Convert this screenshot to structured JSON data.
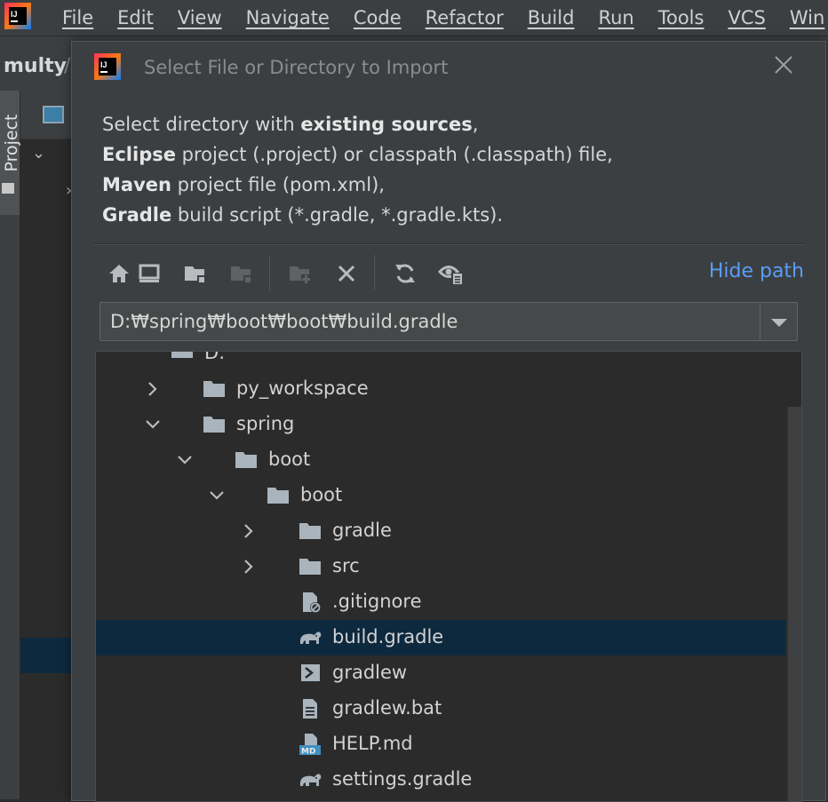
{
  "menubar": {
    "items": [
      "File",
      "Edit",
      "View",
      "Navigate",
      "Code",
      "Refactor",
      "Build",
      "Run",
      "Tools",
      "VCS",
      "Win"
    ]
  },
  "project": {
    "name": "multy",
    "slash": "/",
    "tool_window_label": "Project"
  },
  "dialog": {
    "title": "Select File or Directory to Import",
    "description": {
      "line1_pre": "Select directory with ",
      "line1_bold": "existing sources",
      "line1_post": ",",
      "line2_bold": "Eclipse",
      "line2_post": " project (.project) or classpath (.classpath) file,",
      "line3_bold": "Maven",
      "line3_post": " project file (pom.xml),",
      "line4_bold": "Gradle",
      "line4_post": " build script (*.gradle, *.gradle.kts)."
    },
    "hide_path_label": "Hide path",
    "path_value": "D:₩spring₩boot₩boot₩build.gradle"
  },
  "tree": {
    "rows": [
      {
        "label": "D:",
        "indent": 0,
        "chevron": "none",
        "icon": "drive-icon"
      },
      {
        "label": "py_workspace",
        "indent": 1,
        "chevron": "right",
        "icon": "folder-icon"
      },
      {
        "label": "spring",
        "indent": 1,
        "chevron": "down",
        "icon": "folder-icon"
      },
      {
        "label": "boot",
        "indent": 2,
        "chevron": "down",
        "icon": "folder-icon"
      },
      {
        "label": "boot",
        "indent": 3,
        "chevron": "down",
        "icon": "folder-icon"
      },
      {
        "label": "gradle",
        "indent": 4,
        "chevron": "right",
        "icon": "folder-icon"
      },
      {
        "label": "src",
        "indent": 4,
        "chevron": "right",
        "icon": "folder-icon"
      },
      {
        "label": ".gitignore",
        "indent": 4,
        "chevron": "none",
        "icon": "ignored-file-icon"
      },
      {
        "label": "build.gradle",
        "indent": 4,
        "chevron": "none",
        "icon": "gradle-elephant-icon",
        "selected": true
      },
      {
        "label": "gradlew",
        "indent": 4,
        "chevron": "none",
        "icon": "shell-script-icon"
      },
      {
        "label": "gradlew.bat",
        "indent": 4,
        "chevron": "none",
        "icon": "text-file-icon"
      },
      {
        "label": "HELP.md",
        "indent": 4,
        "chevron": "none",
        "icon": "markdown-file-icon"
      },
      {
        "label": "settings.gradle",
        "indent": 4,
        "chevron": "none",
        "icon": "gradle-elephant-icon"
      }
    ]
  },
  "colors": {
    "accent_link": "#589df6",
    "selection": "#0d293e",
    "folder": "#a9b4bd"
  }
}
